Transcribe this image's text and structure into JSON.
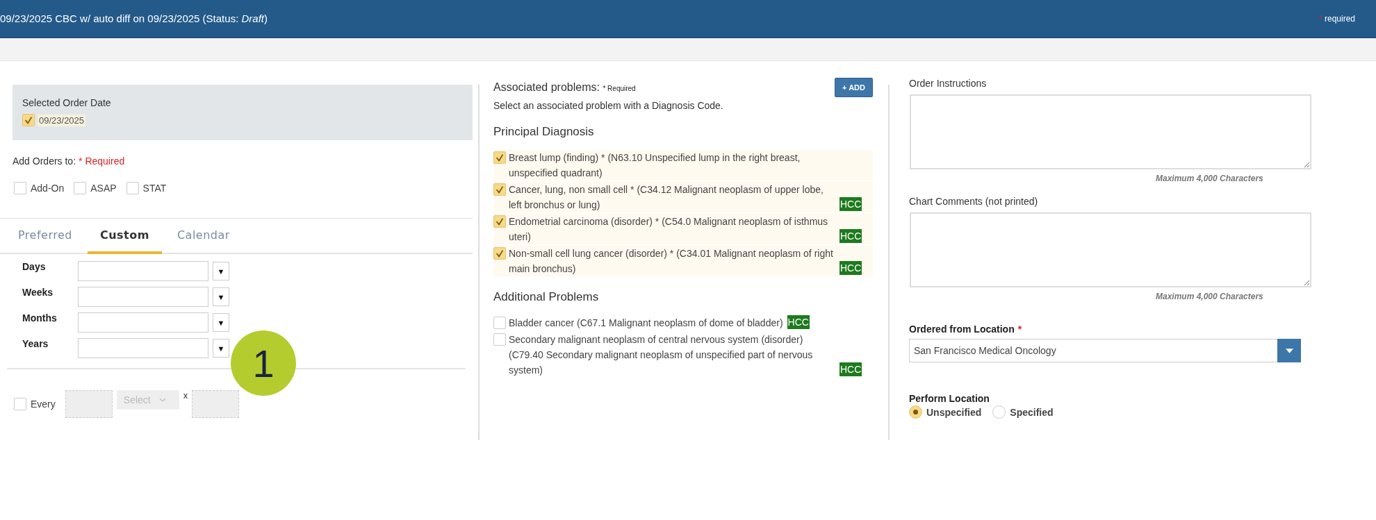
{
  "header": {
    "title": "09/23/2025 CBC w/ auto diff on 09/23/2025 (Status: *Draft*)",
    "required_mark": "*",
    "required_text": "required"
  },
  "order_date": {
    "label": "Selected Order Date",
    "date": "09/23/2025",
    "checked": true
  },
  "add_orders": {
    "label": "Add Orders to:",
    "required": "* Required",
    "options": [
      {
        "label": "Add-On",
        "checked": false
      },
      {
        "label": "ASAP",
        "checked": false
      },
      {
        "label": "STAT",
        "checked": false
      }
    ]
  },
  "tabs": [
    {
      "label": "Preferred",
      "selected": false
    },
    {
      "label": "Custom",
      "selected": true
    },
    {
      "label": "Calendar",
      "selected": false
    }
  ],
  "intervals": [
    {
      "label": "Days",
      "arrow": "▼"
    },
    {
      "label": "Weeks",
      "arrow": "▼"
    },
    {
      "label": "Months",
      "arrow": "▼"
    },
    {
      "label": "Years",
      "arrow": "▼"
    }
  ],
  "callout": "1",
  "every": {
    "label": "Every",
    "checked": false,
    "select_placeholder": "Select",
    "times": "x"
  },
  "problems": {
    "title": "Associated problems:",
    "required": "* Required",
    "add_button": "+ ADD",
    "hint": "Select an associated problem with a Diagnosis Code.",
    "groups": [
      {
        "title": "Principal Diagnosis",
        "items": [
          {
            "text": "Breast lump (finding) * (N63.10 Unspecified lump in the right breast, unspecified quadrant)",
            "checked": true
          },
          {
            "text": "Cancer, lung, non small cell * (C34.12 Malignant neoplasm of upper lobe, left bronchus or lung)",
            "checked": true,
            "tag": "HCC"
          },
          {
            "text": "Endometrial carcinoma (disorder) * (C54.0 Malignant neoplasm of isthmus uteri)",
            "checked": true,
            "tag": "HCC"
          },
          {
            "text": "Non-small cell lung cancer (disorder) * (C34.01 Malignant neoplasm of right main bronchus)",
            "checked": true,
            "tag": "HCC"
          }
        ]
      },
      {
        "title": "Additional Problems",
        "items": [
          {
            "text": "Bladder cancer (C67.1 Malignant neoplasm of dome of bladder)",
            "checked": false,
            "tag": "HCC"
          },
          {
            "text": "Secondary malignant neoplasm of central nervous system (disorder) (C79.40 Secondary malignant neoplasm of unspecified part of nervous system)",
            "checked": false,
            "tag": "HCC"
          }
        ]
      }
    ]
  },
  "order_instructions": {
    "label": "Order Instructions",
    "limit": "Maximum 4,000 Characters"
  },
  "chart_comments": {
    "label": "Chart Comments (not printed)",
    "limit": "Maximum 4,000 Characters"
  },
  "ordered_from": {
    "label": "Ordered from Location",
    "required_mark": "*",
    "value": "San Francisco Medical Oncology"
  },
  "perform_location": {
    "label": "Perform Location",
    "options": [
      {
        "label": "Unspecified",
        "selected": true
      },
      {
        "label": "Specified",
        "selected": false
      }
    ]
  }
}
